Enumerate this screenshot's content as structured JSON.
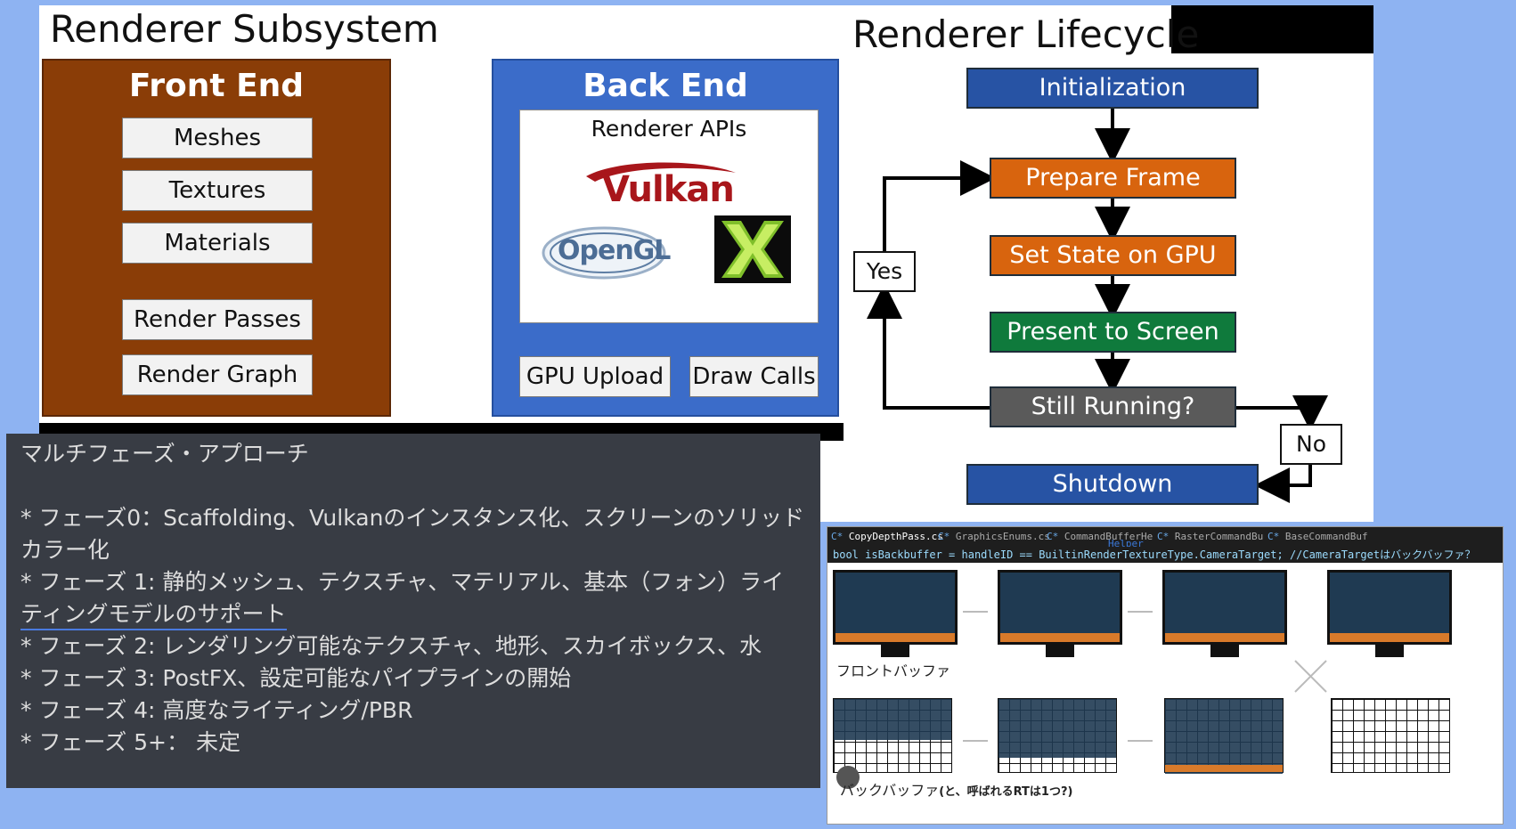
{
  "subsystem": {
    "title": "Renderer Subsystem",
    "front_end": {
      "heading": "Front End",
      "items": [
        "Meshes",
        "Textures",
        "Materials",
        "Render Passes",
        "Render Graph"
      ]
    },
    "back_end": {
      "heading": "Back End",
      "apis_label": "Renderer APIs",
      "logos": {
        "vulkan": "Vulkan",
        "opengl": "OpenGL"
      },
      "buttons": [
        "GPU Upload",
        "Draw Calls"
      ]
    }
  },
  "lifecycle": {
    "title": "Renderer Lifecycle",
    "nodes": {
      "init": "Initialization",
      "prepare": "Prepare Frame",
      "set_state": "Set State on GPU",
      "present": "Present to Screen",
      "running": "Still Running?",
      "shutdown": "Shutdown"
    },
    "yes": "Yes",
    "no": "No"
  },
  "chat": {
    "heading": "マルチフェーズ・アプローチ",
    "lines": [
      "* フェーズ0：Scaffolding、Vulkanのインスタンス化、スクリーンのソリッド",
      "カラー化",
      "* フェーズ 1: 静的メッシュ、テクスチャ、マテリアル、基本（フォン）ライ",
      "ティングモデルのサポート",
      "* フェーズ 2: レンダリング可能なテクスチャ、地形、スカイボックス、水",
      "* フェーズ 3: PostFX、設定可能なパイプラインの開始",
      "* フェーズ 4: 高度なライティング/PBR",
      "* フェーズ 5+： 未定"
    ]
  },
  "code_view": {
    "tabs": [
      "CopyDepthPass.cs",
      "GraphicsEnums.cs",
      "CommandBufferHe",
      "RasterCommandBu",
      "BaseCommandBuf"
    ],
    "helper": "Helper",
    "code_line": "bool isBackbuffer = handleID == BuiltinRenderTextureType.CameraTarget; //CameraTargetはバックバッファ？",
    "front_label": "フロントバッファ",
    "back_label": "バックバッファ",
    "back_note": "(と、呼ばれるRTは1つ?)"
  },
  "colors": {
    "background": "#8eb3f2",
    "front_end": "#8a3d07",
    "back_end": "#3b6cc9",
    "node_blue": "#2753a4",
    "node_orange": "#d8640e",
    "node_green": "#0f7a3c",
    "node_gray": "#5a5a5a",
    "chat_bg": "#383c44"
  }
}
